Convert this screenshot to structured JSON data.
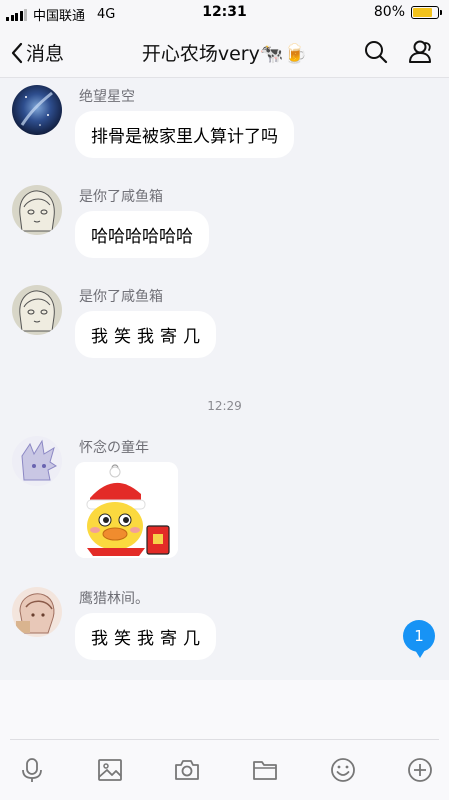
{
  "status_bar": {
    "carrier": "中国联通",
    "network": "4G",
    "time": "12:31",
    "battery_text": "80%",
    "battery_level": 0.8
  },
  "header": {
    "back_label": "消息",
    "title": "开心农场very🐄🍺"
  },
  "messages": [
    {
      "sender": "绝望星空",
      "text": "排骨是被家里人算计了吗"
    },
    {
      "sender": "是你了咸鱼箱",
      "text": "哈哈哈哈哈哈"
    },
    {
      "sender": "是你了咸鱼箱",
      "text": "我笑我寄几"
    },
    {
      "sender": "怀念の童年",
      "sticker": "duck-red-envelope-sticker"
    },
    {
      "sender": "鹰猎林间。",
      "text": "我笑我寄几"
    }
  ],
  "timestamp": "12:29",
  "unread_count": "1",
  "toolbar": [
    "microphone-icon",
    "image-icon",
    "camera-icon",
    "folder-icon",
    "emoji-icon",
    "plus-icon"
  ],
  "colors": {
    "accent": "#1793f5",
    "background": "#f2f3f7",
    "bubble": "#ffffff",
    "battery": "#f2c21b"
  }
}
